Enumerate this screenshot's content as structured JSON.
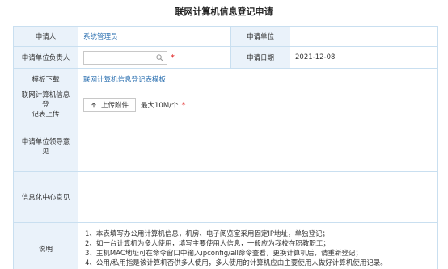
{
  "title": "联网计算机信息登记申请",
  "form": {
    "applicant_label": "申请人",
    "applicant_value": "系统管理员",
    "unit_label": "申请单位",
    "unit_value": "",
    "unit_head_label": "申请单位负责人",
    "unit_head_value": "",
    "date_label": "申请日期",
    "date_value": "2021-12-08",
    "template_label": "模板下载",
    "template_link": "联网计算机信息登记表模板",
    "upload_label_1": "联网计算机信息登",
    "upload_label_2": "记表上传",
    "upload_button": "上传附件",
    "upload_hint": "最大10M/个",
    "leader_opinion_label": "申请单位领导意见",
    "leader_opinion_value": "",
    "it_center_label": "信息化中心意见",
    "it_center_value": "",
    "notes_label": "说明",
    "required_mark": "*"
  },
  "notes": [
    "1、本表填写办公用计算机信息，机房、电子阅览室采用固定IP地址，单独登记；",
    "2、如一台计算机为多人使用，填写主要使用人信息，一般应为我校在职教职工；",
    "3、主机MAC地址可在命令窗口中输入ipconfig/all命令查看，更换计算机后，请重新登记；",
    "4、公用/私用指是该计算机否供多人使用，多人使用的计算机应由主要使用人做好计算机使用记录。"
  ],
  "colors": {
    "label_bg": "#eaf2fa",
    "border": "#c9dff0",
    "link": "#2a6fb0",
    "required": "#e02020"
  },
  "icons": [
    "search-icon",
    "upload-icon"
  ]
}
